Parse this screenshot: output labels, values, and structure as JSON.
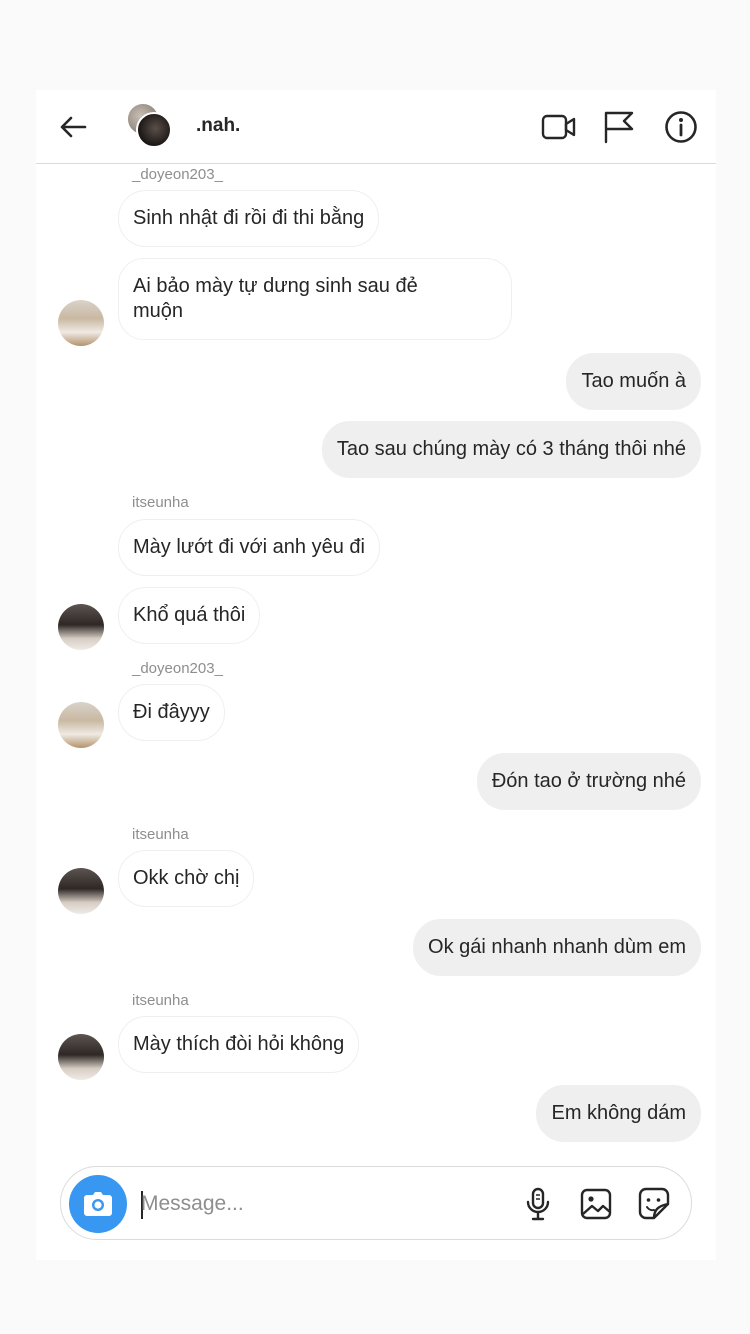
{
  "header": {
    "title": ".nah.",
    "icons": [
      "back-arrow-icon",
      "video-call-icon",
      "flag-icon",
      "info-icon"
    ]
  },
  "messages": [
    {
      "sender": "_doyeon203_",
      "text": "Sinh nhật đi rồi đi thi bằng",
      "dir": "in"
    },
    {
      "text_line1": "Ai bảo mày tự dưng sinh sau đẻ",
      "text_line2": "muộn",
      "dir": "in"
    },
    {
      "text": "Tao muốn à",
      "dir": "out"
    },
    {
      "text": "Tao sau chúng mày có 3 tháng thôi nhé",
      "dir": "out"
    },
    {
      "sender": "itseunha",
      "text": "Mày lướt đi với anh yêu đi",
      "dir": "in"
    },
    {
      "text": "Khổ quá thôi",
      "dir": "in"
    },
    {
      "sender": "_doyeon203_",
      "text": "Đi đâyyy",
      "dir": "in"
    },
    {
      "text": "Đón tao ở trường nhé",
      "dir": "out"
    },
    {
      "sender": "itseunha",
      "text": "Okk chờ chị",
      "dir": "in"
    },
    {
      "text": "Ok gái nhanh nhanh dùm em",
      "dir": "out"
    },
    {
      "sender": "itseunha",
      "text": "Mày thích đòi hỏi không",
      "dir": "in"
    },
    {
      "text": "Em không dám",
      "dir": "out"
    }
  ],
  "composer": {
    "placeholder": "Message...",
    "icons": [
      "camera-icon",
      "microphone-icon",
      "gallery-icon",
      "sticker-icon"
    ]
  },
  "colors": {
    "accent": "#3897f0",
    "outgoing_bubble": "#efefef",
    "incoming_border": "#efefef",
    "secondary_text": "#8e8e8e"
  }
}
